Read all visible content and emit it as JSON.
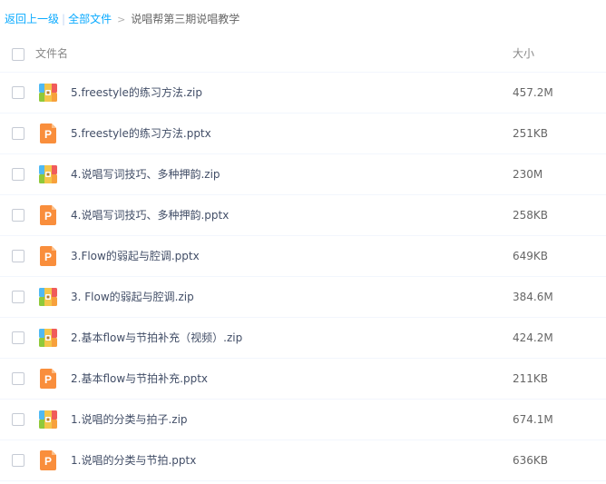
{
  "breadcrumb": {
    "back": "返回上一级",
    "separator": "|",
    "all_files": "全部文件",
    "arrow": ">",
    "current": "说唱帮第三期说唱教学"
  },
  "header": {
    "name_col": "文件名",
    "size_col": "大小"
  },
  "colors": {
    "link": "#09aaff",
    "ppt_icon": "#f98e3c",
    "zip_blue": "#4fb9f3",
    "zip_green": "#8fc93a",
    "zip_orange": "#f7a03c",
    "zip_red": "#f05b5b"
  },
  "files": [
    {
      "name": "5.freestyle的练习方法.zip",
      "size": "457.2M",
      "icon": "zip-icon"
    },
    {
      "name": "5.freestyle的练习方法.pptx",
      "size": "251KB",
      "icon": "ppt-icon"
    },
    {
      "name": "4.说唱写词技巧、多种押韵.zip",
      "size": "230M",
      "icon": "zip-icon"
    },
    {
      "name": "4.说唱写词技巧、多种押韵.pptx",
      "size": "258KB",
      "icon": "ppt-icon"
    },
    {
      "name": "3.Flow的弱起与腔调.pptx",
      "size": "649KB",
      "icon": "ppt-icon"
    },
    {
      "name": "3. Flow的弱起与腔调.zip",
      "size": "384.6M",
      "icon": "zip-icon"
    },
    {
      "name": "2.基本flow与节拍补充（视频）.zip",
      "size": "424.2M",
      "icon": "zip-icon"
    },
    {
      "name": "2.基本flow与节拍补充.pptx",
      "size": "211KB",
      "icon": "ppt-icon"
    },
    {
      "name": "1.说唱的分类与拍子.zip",
      "size": "674.1M",
      "icon": "zip-icon"
    },
    {
      "name": "1.说唱的分类与节拍.pptx",
      "size": "636KB",
      "icon": "ppt-icon"
    }
  ]
}
